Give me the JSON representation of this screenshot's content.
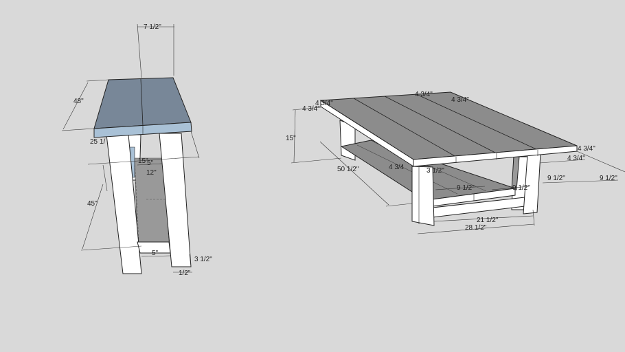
{
  "colors": {
    "background": "#d9d9d9",
    "wood": "#ffffff",
    "top_blue": "#788798",
    "top_light": "#a9c1d6",
    "top_gray": "#8c8c8c",
    "shelf_gray": "#999999"
  },
  "dimensions": {
    "end_table": {
      "top_width": "7 1/2\"",
      "length": "48\"",
      "height_a": "25 1/",
      "gap_a": "5\"",
      "inner": "12\"",
      "span": "15\"",
      "height_b": "45\"",
      "stretcher": "5\"",
      "foot_height": "3 1/2\"",
      "foot_width": "1/2\""
    },
    "coffee_table": {
      "leg_top_a": "4 3/4\"",
      "leg_top_b": "4 3/4\"",
      "board_1": "4 3/4\"",
      "board_2": "4 3/4\"",
      "height": "15\"",
      "length": "50 1/2\"",
      "apron_right": "4 3/4\"",
      "apron_right_b": "4 3/4\"",
      "leg_a": "4 3/4",
      "leg_b": "3 1/2\"",
      "shelf_a": "9 1/2\"",
      "shelf_b": "9 1/2\"",
      "side_a": "9 1/2\"",
      "side_b": "9 1/2\"",
      "stretcher": "21 1/2\"",
      "width": "28 1/2\""
    }
  }
}
